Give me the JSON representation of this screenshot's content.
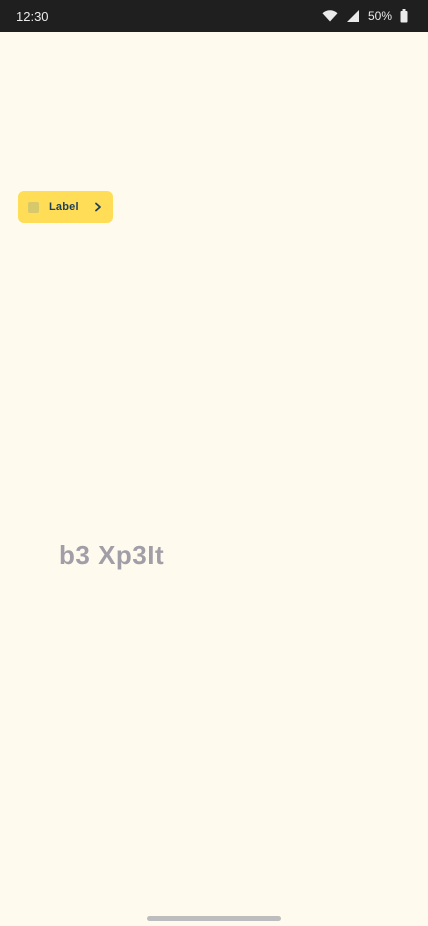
{
  "status_bar": {
    "time": "12:30",
    "battery_percent": "50%",
    "icons": [
      "wifi-icon",
      "cellular-icon",
      "battery-icon"
    ]
  },
  "chip": {
    "label": "Label",
    "leading_icon": "square-icon",
    "trailing_icon": "chevron-right-icon"
  },
  "content": {
    "text": "b3 Xp3It"
  },
  "colors": {
    "background": "#fffaee",
    "statusbar": "#1f1f1f",
    "chip_bg": "#ffdd57",
    "chip_text": "#1f3e57",
    "center_text": "#a19ea7"
  }
}
